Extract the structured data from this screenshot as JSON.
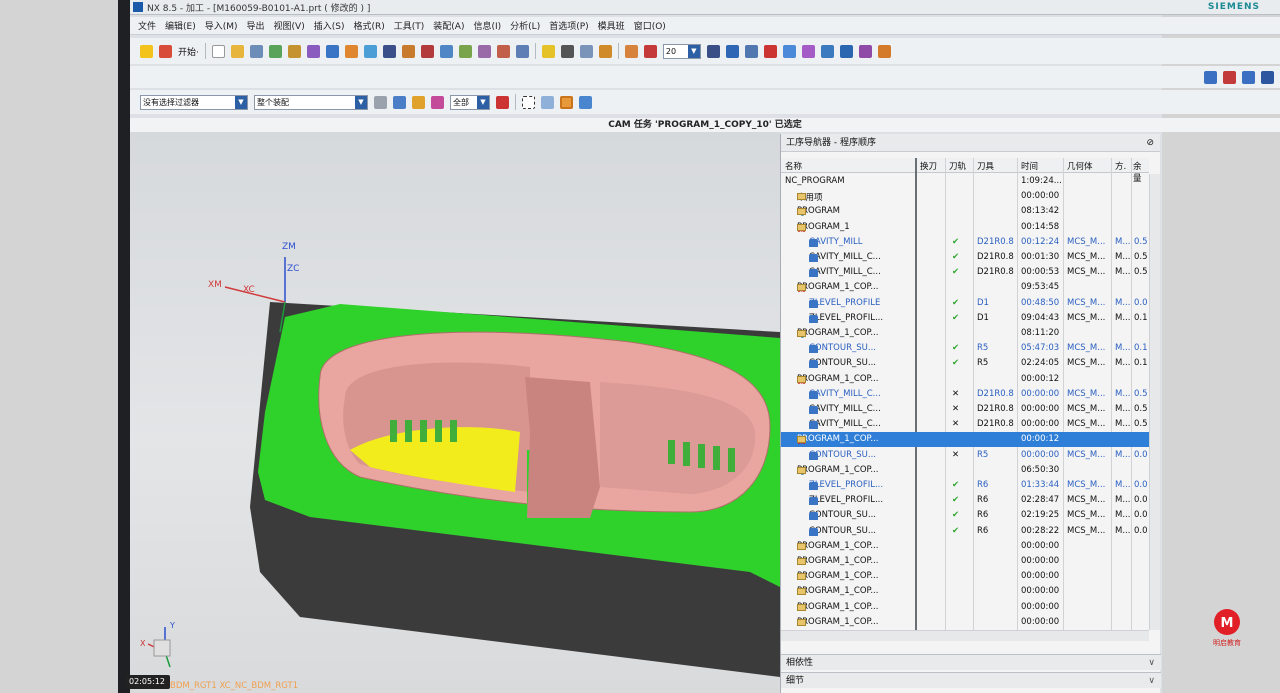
{
  "window": {
    "title": "NX 8.5 - 加工 - [M160059-B0101-A1.prt  ( 修改的 ) ]",
    "brand": "SIEMENS"
  },
  "menu": [
    "文件",
    "编辑(E)",
    "导入(M)",
    "导出",
    "视图(V)",
    "插入(S)",
    "格式(R)",
    "工具(T)",
    "装配(A)",
    "信息(I)",
    "分析(L)",
    "首选项(P)",
    "模具班",
    "窗口(O)"
  ],
  "toolbar": {
    "start_label": "开始·",
    "zoom_value": "20"
  },
  "selection_bar": {
    "filter": "没有选择过滤器",
    "scope": "整个装配",
    "all_label": "全部"
  },
  "status_message": "CAM 任务 'PROGRAM_1_COPY_10' 已选定",
  "navigator": {
    "title": "工序导航器 - 程序顺序",
    "columns": [
      "名称",
      "换刀",
      "刀轨",
      "刀具",
      "时间",
      "几何体",
      "方.",
      "余量"
    ],
    "rows": [
      {
        "name": "NC_PROGRAM",
        "level": 0,
        "icon": "none",
        "status": "",
        "time": "1:09:24...",
        "tool": "",
        "tchg": false,
        "path": "",
        "geom": "",
        "method": "",
        "stock": "",
        "blue": false
      },
      {
        "name": "未用项",
        "level": 1,
        "icon": "folder",
        "status": "",
        "time": "00:00:00",
        "tool": "",
        "tchg": false,
        "path": "",
        "geom": "",
        "method": "",
        "stock": "",
        "blue": false
      },
      {
        "name": "PROGRAM",
        "level": 1,
        "icon": "folder",
        "status": "bulb",
        "time": "08:13:42",
        "tool": "",
        "tchg": false,
        "path": "",
        "geom": "",
        "method": "",
        "stock": "",
        "blue": false
      },
      {
        "name": "PROGRAM_1",
        "level": 1,
        "icon": "folder",
        "status": "no",
        "time": "00:14:58",
        "tool": "",
        "tchg": false,
        "path": "",
        "geom": "",
        "method": "",
        "stock": "",
        "blue": false
      },
      {
        "name": "CAVITY_MILL",
        "level": 2,
        "icon": "mill",
        "status": "no",
        "time": "00:12:24",
        "tool": "D21R0.8",
        "tchg": true,
        "path": "check",
        "geom": "MCS_M...",
        "method": "M...",
        "stock": "0.5",
        "blue": true
      },
      {
        "name": "CAVITY_MILL_C...",
        "level": 2,
        "icon": "mill",
        "status": "no",
        "time": "00:01:30",
        "tool": "D21R0.8",
        "tchg": false,
        "path": "check",
        "geom": "MCS_M...",
        "method": "M...",
        "stock": "0.5",
        "blue": false
      },
      {
        "name": "CAVITY_MILL_C...",
        "level": 2,
        "icon": "mill",
        "status": "no",
        "time": "00:00:53",
        "tool": "D21R0.8",
        "tchg": false,
        "path": "check",
        "geom": "MCS_M...",
        "method": "M...",
        "stock": "0.5",
        "blue": false
      },
      {
        "name": "PROGRAM_1_COP...",
        "level": 1,
        "icon": "folder",
        "status": "no",
        "time": "09:53:45",
        "tool": "",
        "tchg": false,
        "path": "",
        "geom": "",
        "method": "",
        "stock": "",
        "blue": false
      },
      {
        "name": "ZLEVEL_PROFILE",
        "level": 2,
        "icon": "mill",
        "status": "no",
        "time": "00:48:50",
        "tool": "D1",
        "tchg": true,
        "path": "check",
        "geom": "MCS_M...",
        "method": "M...",
        "stock": "0.0",
        "blue": true
      },
      {
        "name": "ZLEVEL_PROFIL...",
        "level": 2,
        "icon": "mill",
        "status": "no",
        "time": "09:04:43",
        "tool": "D1",
        "tchg": false,
        "path": "check",
        "geom": "MCS_M...",
        "method": "M...",
        "stock": "0.1",
        "blue": false
      },
      {
        "name": "PROGRAM_1_COP...",
        "level": 1,
        "icon": "folder",
        "status": "bulb",
        "time": "08:11:20",
        "tool": "",
        "tchg": false,
        "path": "",
        "geom": "",
        "method": "",
        "stock": "",
        "blue": false
      },
      {
        "name": "CONTOUR_SU...",
        "level": 2,
        "icon": "mill",
        "status": "bulb",
        "time": "05:47:03",
        "tool": "R5",
        "tchg": true,
        "path": "check",
        "geom": "MCS_M...",
        "method": "M...",
        "stock": "0.1",
        "blue": true
      },
      {
        "name": "CONTOUR_SU...",
        "level": 2,
        "icon": "mill",
        "status": "bulb",
        "time": "02:24:05",
        "tool": "R5",
        "tchg": false,
        "path": "check",
        "geom": "MCS_M...",
        "method": "M...",
        "stock": "0.1",
        "blue": false
      },
      {
        "name": "PROGRAM_1_COP...",
        "level": 1,
        "icon": "folder",
        "status": "no",
        "time": "00:00:12",
        "tool": "",
        "tchg": false,
        "path": "",
        "geom": "",
        "method": "",
        "stock": "",
        "blue": false
      },
      {
        "name": "CAVITY_MILL_C...",
        "level": 2,
        "icon": "mill",
        "status": "no",
        "time": "00:00:00",
        "tool": "D21R0.8",
        "tchg": true,
        "path": "cross",
        "geom": "MCS_M...",
        "method": "M...",
        "stock": "0.5",
        "blue": true
      },
      {
        "name": "CAVITY_MILL_C...",
        "level": 2,
        "icon": "mill",
        "status": "no",
        "time": "00:00:00",
        "tool": "D21R0.8",
        "tchg": false,
        "path": "cross",
        "geom": "MCS_M...",
        "method": "M...",
        "stock": "0.5",
        "blue": false
      },
      {
        "name": "CAVITY_MILL_C...",
        "level": 2,
        "icon": "mill",
        "status": "no",
        "time": "00:00:00",
        "tool": "D21R0.8",
        "tchg": false,
        "path": "cross",
        "geom": "MCS_M...",
        "method": "M...",
        "stock": "0.5",
        "blue": false
      },
      {
        "name": "PROGRAM_1_COP...",
        "level": 1,
        "icon": "folder",
        "status": "no",
        "time": "00:00:12",
        "tool": "",
        "tchg": false,
        "path": "",
        "geom": "",
        "method": "",
        "stock": "",
        "blue": false,
        "selected": true
      },
      {
        "name": "CONTOUR_SU...",
        "level": 2,
        "icon": "mill",
        "status": "no",
        "time": "00:00:00",
        "tool": "R5",
        "tchg": true,
        "path": "cross",
        "geom": "MCS_M...",
        "method": "M...",
        "stock": "0.0",
        "blue": true
      },
      {
        "name": "PROGRAM_1_COP...",
        "level": 1,
        "icon": "folder",
        "status": "bulb",
        "time": "06:50:30",
        "tool": "",
        "tchg": false,
        "path": "",
        "geom": "",
        "method": "",
        "stock": "",
        "blue": false
      },
      {
        "name": "ZLEVEL_PROFIL...",
        "level": 2,
        "icon": "mill",
        "status": "bulb",
        "time": "01:33:44",
        "tool": "R6",
        "tchg": true,
        "path": "check",
        "geom": "MCS_M...",
        "method": "M...",
        "stock": "0.0",
        "blue": true
      },
      {
        "name": "ZLEVEL_PROFIL...",
        "level": 2,
        "icon": "mill",
        "status": "bulb",
        "time": "02:28:47",
        "tool": "R6",
        "tchg": false,
        "path": "check",
        "geom": "MCS_M...",
        "method": "M...",
        "stock": "0.0",
        "blue": false
      },
      {
        "name": "CONTOUR_SU...",
        "level": 2,
        "icon": "mill",
        "status": "bulb",
        "time": "02:19:25",
        "tool": "R6",
        "tchg": false,
        "path": "check",
        "geom": "MCS_M...",
        "method": "M...",
        "stock": "0.0",
        "blue": false
      },
      {
        "name": "CONTOUR_SU...",
        "level": 2,
        "icon": "mill",
        "status": "bulb",
        "time": "00:28:22",
        "tool": "R6",
        "tchg": false,
        "path": "check",
        "geom": "MCS_M...",
        "method": "M...",
        "stock": "0.0",
        "blue": false
      },
      {
        "name": "PROGRAM_1_COP...",
        "level": 1,
        "icon": "folder",
        "status": "check",
        "time": "00:00:00",
        "tool": "",
        "tchg": false,
        "path": "",
        "geom": "",
        "method": "",
        "stock": "",
        "blue": false
      },
      {
        "name": "PROGRAM_1_COP...",
        "level": 1,
        "icon": "folder",
        "status": "check",
        "time": "00:00:00",
        "tool": "",
        "tchg": false,
        "path": "",
        "geom": "",
        "method": "",
        "stock": "",
        "blue": false
      },
      {
        "name": "PROGRAM_1_COP...",
        "level": 1,
        "icon": "folder",
        "status": "check",
        "time": "00:00:00",
        "tool": "",
        "tchg": false,
        "path": "",
        "geom": "",
        "method": "",
        "stock": "",
        "blue": false
      },
      {
        "name": "PROGRAM_1_COP...",
        "level": 1,
        "icon": "folder",
        "status": "check",
        "time": "00:00:00",
        "tool": "",
        "tchg": false,
        "path": "",
        "geom": "",
        "method": "",
        "stock": "",
        "blue": false
      },
      {
        "name": "PROGRAM_1_COP...",
        "level": 1,
        "icon": "folder",
        "status": "check",
        "time": "00:00:00",
        "tool": "",
        "tchg": false,
        "path": "",
        "geom": "",
        "method": "",
        "stock": "",
        "blue": false
      },
      {
        "name": "PROGRAM_1_COP...",
        "level": 1,
        "icon": "folder",
        "status": "check",
        "time": "00:00:00",
        "tool": "",
        "tchg": false,
        "path": "",
        "geom": "",
        "method": "",
        "stock": "",
        "blue": false
      }
    ],
    "panels": [
      "相依性",
      "细节"
    ]
  },
  "viewport": {
    "axes": {
      "zm": "ZM",
      "zc": "ZC",
      "xm": "XM",
      "xc": "XC"
    },
    "triad": {
      "x": "X",
      "y": "Y"
    },
    "bottom_label": "BDM_RGT1  XC_NC_BDM_RGT1"
  },
  "timer": "02:05:12",
  "watermark": "明启教育"
}
